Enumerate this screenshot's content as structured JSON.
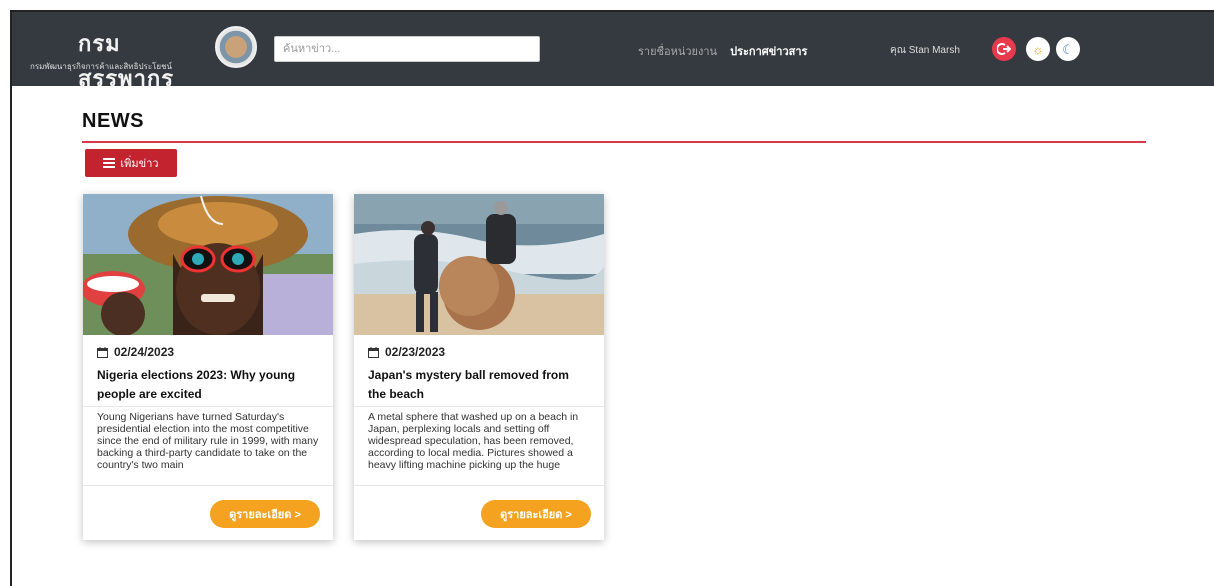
{
  "header": {
    "brand_title": "กรมสรรพากร",
    "brand_subtitle": "กรมพัฒนาธุรกิจการค้าและสิทธิประโยชน์",
    "search_placeholder": "ค้นหาข่าว...",
    "nav": [
      {
        "label": "รายชื่อหน่วยงาน"
      },
      {
        "label": "ประกาศข่าวสาร"
      }
    ],
    "user_label": "คุณ Stan Marsh",
    "colors": {
      "navbar": "#343a40",
      "logout": "#e8394d"
    },
    "icons": {
      "logout": "logout-icon",
      "theme_light": "sun-icon",
      "theme_dark": "moon-icon"
    }
  },
  "page": {
    "title": "NEWS",
    "add_button_label": "เพิ่มข่าว",
    "accent_color": "#d8394a"
  },
  "cards": [
    {
      "date": "02/24/2023",
      "title": "Nigeria elections 2023: Why young people are excited",
      "description": "Young Nigerians have turned Saturday's presidential election into the most competitive since the end of military rule in 1999, with many backing a third-party candidate to take on the country's two main",
      "button_label": "ดูรายละเอียด >"
    },
    {
      "date": "02/23/2023",
      "title": "Japan's mystery ball removed from the beach",
      "description": "A metal sphere that washed up on a beach in Japan, perplexing locals and setting off widespread speculation, has been removed, according to local media. Pictures showed a heavy lifting machine picking up the huge",
      "button_label": "ดูรายละเอียด >"
    }
  ]
}
